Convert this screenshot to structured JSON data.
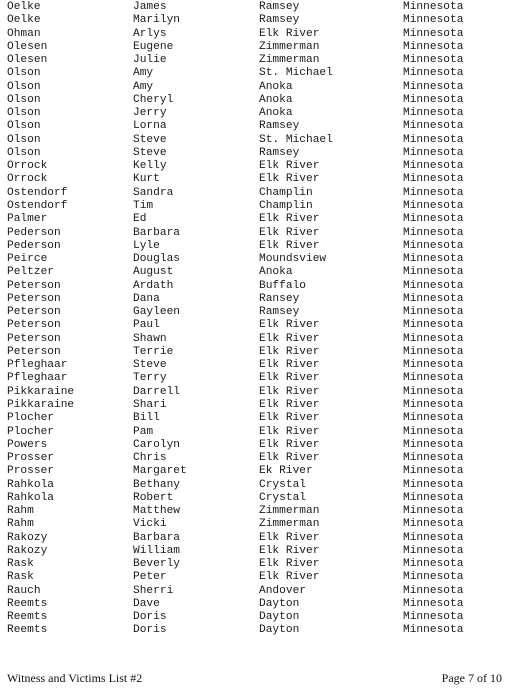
{
  "document": {
    "columns": [
      "last_name",
      "first_name",
      "city",
      "state"
    ],
    "rows": [
      [
        "Oelke",
        "James",
        "Ramsey",
        "Minnesota"
      ],
      [
        "Oelke",
        "Marilyn",
        "Ramsey",
        "Minnesota"
      ],
      [
        "Ohman",
        "Arlys",
        "Elk River",
        "Minnesota"
      ],
      [
        "Olesen",
        "Eugene",
        "Zimmerman",
        "Minnesota"
      ],
      [
        "Olesen",
        "Julie",
        "Zimmerman",
        "Minnesota"
      ],
      [
        "Olson",
        "Amy",
        "St. Michael",
        "Minnesota"
      ],
      [
        "Olson",
        "Amy",
        "Anoka",
        "Minnesota"
      ],
      [
        "Olson",
        "Cheryl",
        "Anoka",
        "Minnesota"
      ],
      [
        "Olson",
        "Jerry",
        "Anoka",
        "Minnesota"
      ],
      [
        "Olson",
        "Lorna",
        "Ramsey",
        "Minnesota"
      ],
      [
        "Olson",
        "Steve",
        "St. Michael",
        "Minnesota"
      ],
      [
        "Olson",
        "Steve",
        "Ramsey",
        "Minnesota"
      ],
      [
        "Orrock",
        "Kelly",
        "Elk River",
        "Minnesota"
      ],
      [
        "Orrock",
        "Kurt",
        "Elk River",
        "Minnesota"
      ],
      [
        "Ostendorf",
        "Sandra",
        "Champlin",
        "Minnesota"
      ],
      [
        "Ostendorf",
        "Tim",
        "Champlin",
        "Minnesota"
      ],
      [
        "Palmer",
        "Ed",
        "Elk River",
        "Minnesota"
      ],
      [
        "Pederson",
        "Barbara",
        "Elk River",
        "Minnesota"
      ],
      [
        "Pederson",
        "Lyle",
        "Elk River",
        "Minnesota"
      ],
      [
        "Peirce",
        "Douglas",
        "Moundsview",
        "Minnesota"
      ],
      [
        "Peltzer",
        "August",
        "Anoka",
        "Minnesota"
      ],
      [
        "Peterson",
        "Ardath",
        "Buffalo",
        "Minnesota"
      ],
      [
        "Peterson",
        "Dana",
        "Ransey",
        "Minnesota"
      ],
      [
        "Peterson",
        "Gayleen",
        "Ramsey",
        "Minnesota"
      ],
      [
        "Peterson",
        "Paul",
        "Elk River",
        "Minnesota"
      ],
      [
        "Peterson",
        "Shawn",
        "Elk River",
        "Minnesota"
      ],
      [
        "Peterson",
        "Terrie",
        "Elk River",
        "Minnesota"
      ],
      [
        "Pfleghaar",
        "Steve",
        "Elk River",
        "Minnesota"
      ],
      [
        "Pfleghaar",
        "Terry",
        "Elk River",
        "Minnesota"
      ],
      [
        "Pikkaraine",
        "Darrell",
        "Elk River",
        "Minnesota"
      ],
      [
        "Pikkaraine",
        "Shari",
        "Elk River",
        "Minnesota"
      ],
      [
        "Plocher",
        "Bill",
        "Elk River",
        "Minnesota"
      ],
      [
        "Plocher",
        "Pam",
        "Elk River",
        "Minnesota"
      ],
      [
        "Powers",
        "Carolyn",
        "Elk River",
        "Minnesota"
      ],
      [
        "Prosser",
        "Chris",
        "Elk River",
        "Minnesota"
      ],
      [
        "Prosser",
        "Margaret",
        "Ek River",
        "Minnesota"
      ],
      [
        "Rahkola",
        "Bethany",
        "Crystal",
        "Minnesota"
      ],
      [
        "Rahkola",
        "Robert",
        "Crystal",
        "Minnesota"
      ],
      [
        "Rahm",
        "Matthew",
        "Zimmerman",
        "Minnesota"
      ],
      [
        "Rahm",
        "Vicki",
        "Zimmerman",
        "Minnesota"
      ],
      [
        "Rakozy",
        "Barbara",
        "Elk River",
        "Minnesota"
      ],
      [
        "Rakozy",
        "William",
        "Elk River",
        "Minnesota"
      ],
      [
        "Rask",
        "Beverly",
        "Elk River",
        "Minnesota"
      ],
      [
        "Rask",
        "Peter",
        "Elk River",
        "Minnesota"
      ],
      [
        "Rauch",
        "Sherri",
        "Andover",
        "Minnesota"
      ],
      [
        "Reemts",
        "Dave",
        "Dayton",
        "Minnesota"
      ],
      [
        "Reemts",
        "Doris",
        "Dayton",
        "Minnesota"
      ],
      [
        "Reemts",
        "Doris",
        "Dayton",
        "Minnesota"
      ]
    ]
  },
  "footer": {
    "title": "Witness and Victims List #2",
    "page": "Page 7 of 10"
  }
}
